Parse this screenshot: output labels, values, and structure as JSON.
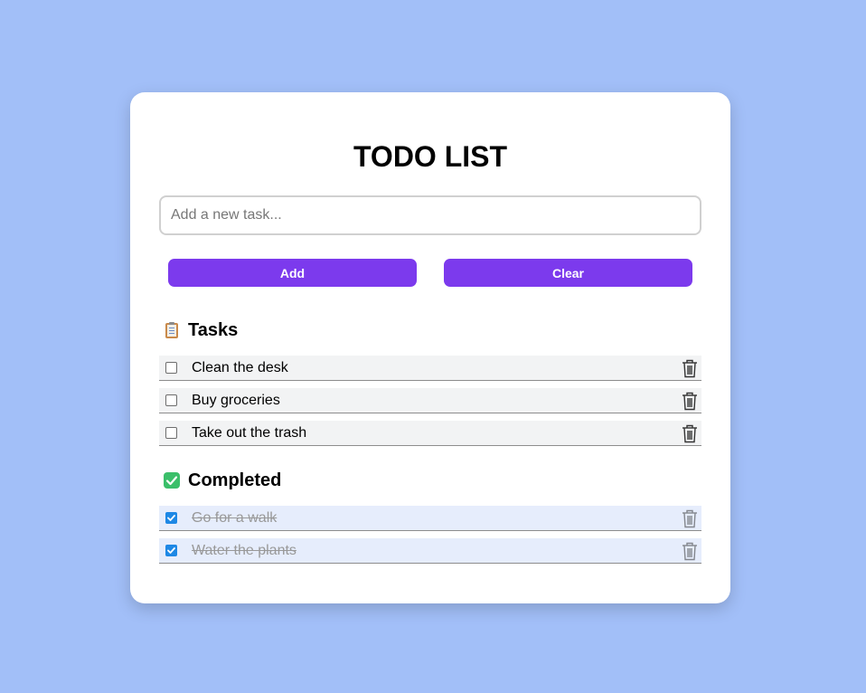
{
  "app": {
    "title": "TODO LIST"
  },
  "input": {
    "placeholder": "Add a new task...",
    "value": ""
  },
  "buttons": {
    "add_label": "Add",
    "clear_label": "Clear"
  },
  "sections": {
    "tasks": {
      "icon": "clipboard-icon",
      "label": "Tasks"
    },
    "completed": {
      "icon": "check-mark-icon",
      "label": "Completed"
    }
  },
  "tasks": [
    {
      "text": "Clean the desk",
      "checked": false
    },
    {
      "text": "Buy groceries",
      "checked": false
    },
    {
      "text": "Take out the trash",
      "checked": false
    }
  ],
  "completed": [
    {
      "text": "Go for a walk",
      "checked": true
    },
    {
      "text": "Water the plants",
      "checked": true
    }
  ],
  "colors": {
    "page_background": "#a2bff8",
    "accent": "#7c3aed",
    "pending_row": "#f2f3f4",
    "completed_row": "#e6edfc",
    "checkbox_checked": "#1e88e5",
    "completed_check_icon": "#3bbf6a"
  }
}
